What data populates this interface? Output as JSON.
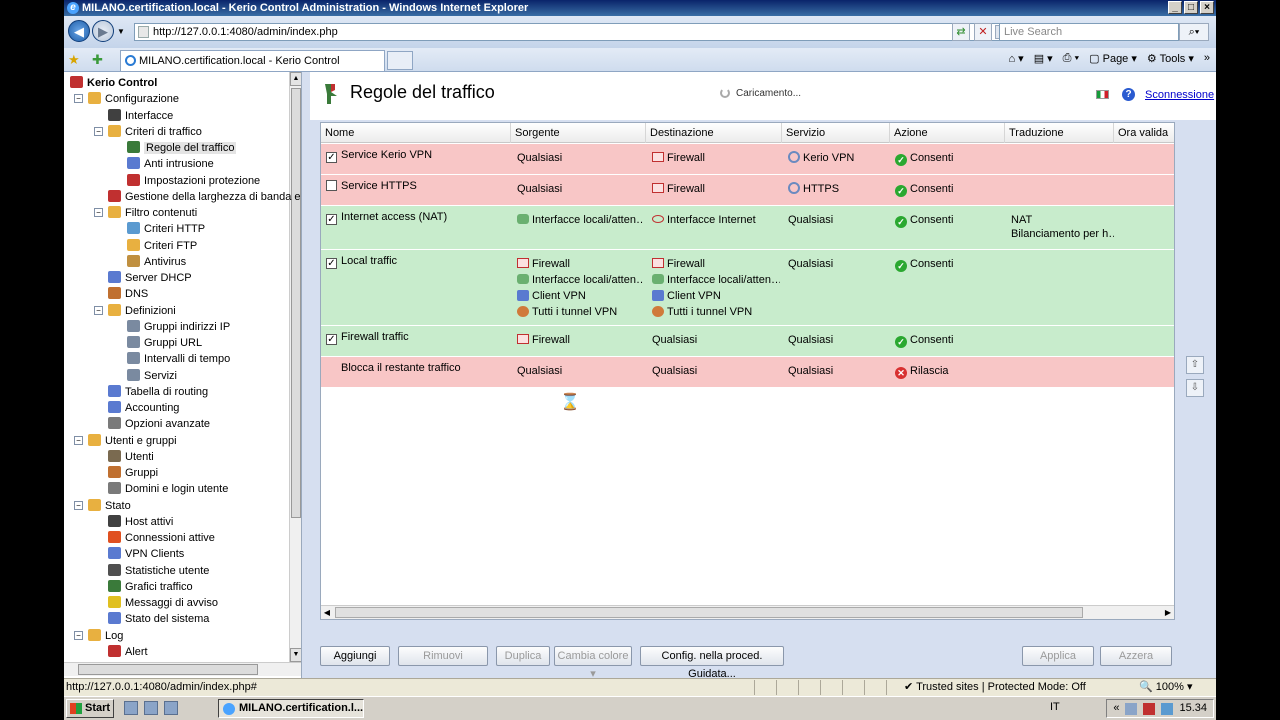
{
  "window": {
    "title": "MILANO.certification.local - Kerio Control Administration - Windows Internet Explorer",
    "url": "http://127.0.0.1:4080/admin/index.php",
    "search_placeholder": "Live Search",
    "tab_title": "MILANO.certification.local - Kerio Control Administration",
    "cmd_page": "Page",
    "cmd_tools": "Tools"
  },
  "tree": [
    {
      "label": "Kerio Control",
      "level": 0,
      "bold": true,
      "icon": "kerio-icon",
      "color": "#c03030"
    },
    {
      "label": "Configurazione",
      "level": 1,
      "expander": "⊟",
      "icon": "folder-icon",
      "color": "#e8b040"
    },
    {
      "label": "Interfacce",
      "level": 2,
      "icon": "interfaces-icon",
      "color": "#404040"
    },
    {
      "label": "Criteri di traffico",
      "level": 2,
      "expander": "⊟",
      "icon": "folder-icon",
      "color": "#e8b040"
    },
    {
      "label": "Regole del traffico",
      "level": 3,
      "selected": true,
      "icon": "traffic-rule-icon",
      "color": "#3a7a3a"
    },
    {
      "label": "Anti intrusione",
      "level": 3,
      "icon": "shield-icon",
      "color": "#5a7ad0"
    },
    {
      "label": "Impostazioni protezione",
      "level": 3,
      "icon": "protection-icon",
      "color": "#c03030"
    },
    {
      "label": "Gestione della larghezza di banda e Q",
      "level": 2,
      "icon": "bandwidth-icon",
      "color": "#c03030"
    },
    {
      "label": "Filtro contenuti",
      "level": 2,
      "expander": "⊟",
      "icon": "folder-icon",
      "color": "#e8b040"
    },
    {
      "label": "Criteri HTTP",
      "level": 3,
      "icon": "http-icon",
      "color": "#5a9ad0"
    },
    {
      "label": "Criteri FTP",
      "level": 3,
      "icon": "ftp-icon",
      "color": "#e8b040"
    },
    {
      "label": "Antivirus",
      "level": 3,
      "icon": "antivirus-icon",
      "color": "#c09040"
    },
    {
      "label": "Server DHCP",
      "level": 2,
      "icon": "dhcp-icon",
      "color": "#5a7ad0"
    },
    {
      "label": "DNS",
      "level": 2,
      "icon": "dns-icon",
      "color": "#c07030"
    },
    {
      "label": "Definizioni",
      "level": 2,
      "expander": "⊟",
      "icon": "folder-icon",
      "color": "#e8b040"
    },
    {
      "label": "Gruppi indirizzi IP",
      "level": 3,
      "icon": "ip-groups-icon",
      "color": "#7a8aa0"
    },
    {
      "label": "Gruppi URL",
      "level": 3,
      "icon": "url-groups-icon",
      "color": "#7a8aa0"
    },
    {
      "label": "Intervalli di tempo",
      "level": 3,
      "icon": "time-ranges-icon",
      "color": "#7a8aa0"
    },
    {
      "label": "Servizi",
      "level": 3,
      "icon": "services-icon",
      "color": "#7a8aa0"
    },
    {
      "label": "Tabella di routing",
      "level": 2,
      "icon": "routing-icon",
      "color": "#5a7ad0"
    },
    {
      "label": "Accounting",
      "level": 2,
      "icon": "accounting-icon",
      "color": "#5a7ad0"
    },
    {
      "label": "Opzioni avanzate",
      "level": 2,
      "icon": "advanced-icon",
      "color": "#7a7a7a"
    },
    {
      "label": "Utenti e gruppi",
      "level": 1,
      "expander": "⊟",
      "icon": "folder-icon",
      "color": "#e8b040"
    },
    {
      "label": "Utenti",
      "level": 2,
      "icon": "user-icon",
      "color": "#7a6a50"
    },
    {
      "label": "Gruppi",
      "level": 2,
      "icon": "group-icon",
      "color": "#c07030"
    },
    {
      "label": "Domini e login utente",
      "level": 2,
      "icon": "domain-icon",
      "color": "#7a7a7a"
    },
    {
      "label": "Stato",
      "level": 1,
      "expander": "⊟",
      "icon": "folder-icon",
      "color": "#e8b040"
    },
    {
      "label": "Host attivi",
      "level": 2,
      "icon": "active-hosts-icon",
      "color": "#404040"
    },
    {
      "label": "Connessioni attive",
      "level": 2,
      "icon": "connections-icon",
      "color": "#e05020"
    },
    {
      "label": "VPN Clients",
      "level": 2,
      "icon": "vpn-clients-icon",
      "color": "#5a7ad0"
    },
    {
      "label": "Statistiche utente",
      "level": 2,
      "icon": "user-stats-icon",
      "color": "#505050"
    },
    {
      "label": "Grafici traffico",
      "level": 2,
      "icon": "traffic-chart-icon",
      "color": "#3a7a3a"
    },
    {
      "label": "Messaggi di avviso",
      "level": 2,
      "icon": "warning-icon",
      "color": "#e0c020"
    },
    {
      "label": "Stato del sistema",
      "level": 2,
      "icon": "system-status-icon",
      "color": "#5a7ad0"
    },
    {
      "label": "Log",
      "level": 1,
      "expander": "⊟",
      "icon": "folder-icon",
      "color": "#e8b040"
    },
    {
      "label": "Alert",
      "level": 2,
      "icon": "alert-log-icon",
      "color": "#c03030"
    }
  ],
  "page": {
    "title": "Regole del traffico",
    "loading": "Caricamento...",
    "logout": "Sconnessione",
    "help": "?"
  },
  "columns": [
    "Nome",
    "Sorgente",
    "Destinazione",
    "Servizio",
    "Azione",
    "Traduzione",
    "Ora valida"
  ],
  "rules": [
    {
      "name": "Service Kerio VPN",
      "checked": true,
      "color": "red",
      "source": [
        {
          "t": "Qualsiasi"
        }
      ],
      "dest": [
        {
          "t": "Firewall",
          "i": "fw"
        }
      ],
      "service": [
        {
          "t": "Kerio VPN",
          "i": "svc"
        }
      ],
      "action": {
        "t": "Consenti",
        "ok": true
      },
      "translation": []
    },
    {
      "name": "Service HTTPS",
      "checked": false,
      "color": "red",
      "source": [
        {
          "t": "Qualsiasi"
        }
      ],
      "dest": [
        {
          "t": "Firewall",
          "i": "fw"
        }
      ],
      "service": [
        {
          "t": "HTTPS",
          "i": "svc"
        }
      ],
      "action": {
        "t": "Consenti",
        "ok": true
      },
      "translation": []
    },
    {
      "name": "Internet access (NAT)",
      "checked": true,
      "color": "green",
      "source": [
        {
          "t": "Interfacce locali/atten…",
          "i": "net"
        }
      ],
      "dest": [
        {
          "t": "Interfacce Internet",
          "i": "int"
        }
      ],
      "service": [
        {
          "t": "Qualsiasi"
        }
      ],
      "action": {
        "t": "Consenti",
        "ok": true
      },
      "translation": [
        "NAT",
        "Bilanciamento per h…"
      ]
    },
    {
      "name": "Local traffic",
      "checked": true,
      "color": "green",
      "source": [
        {
          "t": "Firewall",
          "i": "fw"
        },
        {
          "t": "Interfacce locali/atten…",
          "i": "net"
        },
        {
          "t": "Client VPN",
          "i": "vpn"
        },
        {
          "t": "Tutti i tunnel VPN",
          "i": "tun"
        }
      ],
      "dest": [
        {
          "t": "Firewall",
          "i": "fw"
        },
        {
          "t": "Interfacce locali/atten…",
          "i": "net"
        },
        {
          "t": "Client VPN",
          "i": "vpn"
        },
        {
          "t": "Tutti i tunnel VPN",
          "i": "tun"
        }
      ],
      "service": [
        {
          "t": "Qualsiasi"
        }
      ],
      "action": {
        "t": "Consenti",
        "ok": true
      },
      "translation": []
    },
    {
      "name": "Firewall traffic",
      "checked": true,
      "color": "green",
      "source": [
        {
          "t": "Firewall",
          "i": "fw"
        }
      ],
      "dest": [
        {
          "t": "Qualsiasi"
        }
      ],
      "service": [
        {
          "t": "Qualsiasi"
        }
      ],
      "action": {
        "t": "Consenti",
        "ok": true
      },
      "translation": []
    },
    {
      "name": "Blocca il restante traffico",
      "checked": null,
      "color": "red",
      "source": [
        {
          "t": "Qualsiasi"
        }
      ],
      "dest": [
        {
          "t": "Qualsiasi"
        }
      ],
      "service": [
        {
          "t": "Qualsiasi"
        }
      ],
      "action": {
        "t": "Rilascia",
        "ok": false
      },
      "translation": []
    }
  ],
  "buttons": {
    "add": "Aggiungi",
    "remove": "Rimuovi",
    "duplicate": "Duplica",
    "color": "Cambia colore",
    "wizard": "Config. nella proced. Guidata...",
    "apply": "Applica",
    "reset": "Azzera"
  },
  "statusbar": {
    "url": "http://127.0.0.1:4080/admin/index.php#",
    "zone": "Trusted sites | Protected Mode: Off",
    "zoom": "100%"
  },
  "taskbar": {
    "start": "Start",
    "task": "MILANO.certification.l...",
    "lang": "IT",
    "clock": "15.34"
  },
  "colors": {
    "row_red": "#f8c6c6",
    "row_green": "#c8eccc"
  }
}
